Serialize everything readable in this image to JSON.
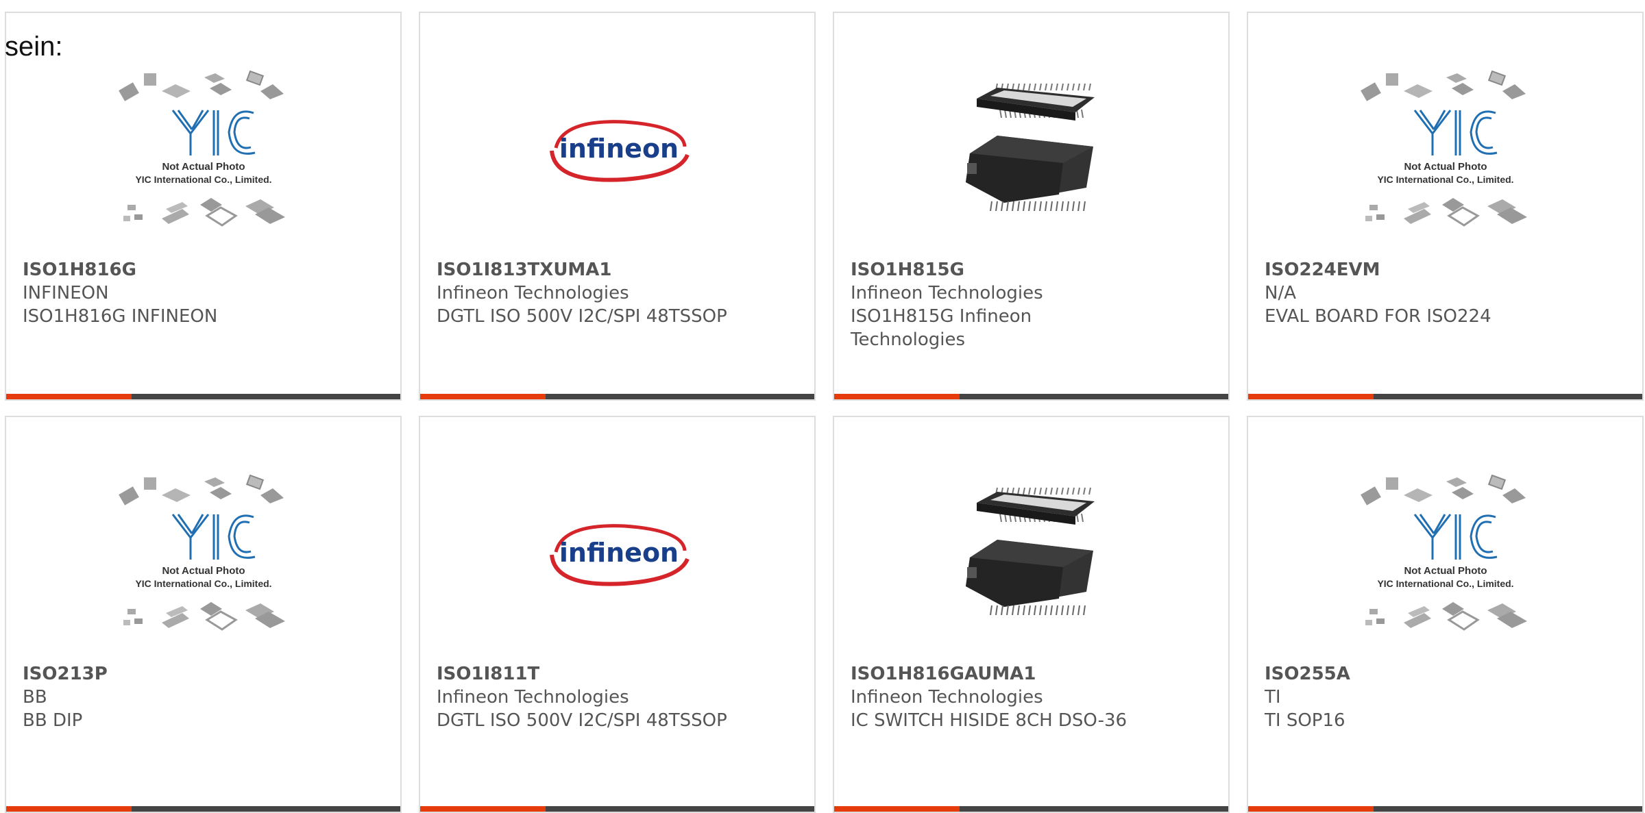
{
  "lead_text": "sein:",
  "placeholder": {
    "line1": "Not Actual Photo",
    "line2": "YIC International Co., Limited."
  },
  "brand_logo_text": "infineon",
  "colors": {
    "accent": "#e63c0c",
    "bar": "#444444",
    "text": "#555555",
    "yic_blue": "#1f6fb2",
    "infineon_red": "#d6242b",
    "infineon_blue": "#1a3f8a"
  },
  "products": [
    {
      "part": "ISO1H816G",
      "manufacturer": "INFINEON",
      "description": "ISO1H816G INFINEON",
      "image": "placeholder"
    },
    {
      "part": "ISO1I813TXUMA1",
      "manufacturer": "Infineon Technologies",
      "description": "DGTL ISO 500V I2C/SPI 48TSSOP",
      "image": "infineon-logo"
    },
    {
      "part": "ISO1H815G",
      "manufacturer": "Infineon Technologies",
      "description": "ISO1H815G Infineon Technologies",
      "image": "chip-photo"
    },
    {
      "part": "ISO224EVM",
      "manufacturer": "N/A",
      "description": "EVAL BOARD FOR ISO224",
      "image": "placeholder"
    },
    {
      "part": "ISO213P",
      "manufacturer": "BB",
      "description": "BB DIP",
      "image": "placeholder"
    },
    {
      "part": "ISO1I811T",
      "manufacturer": "Infineon Technologies",
      "description": "DGTL ISO 500V I2C/SPI 48TSSOP",
      "image": "infineon-logo"
    },
    {
      "part": "ISO1H816GAUMA1",
      "manufacturer": "Infineon Technologies",
      "description": "IC SWITCH HISIDE 8CH DSO-36",
      "image": "chip-photo"
    },
    {
      "part": "ISO255A",
      "manufacturer": "TI",
      "description": "TI SOP16",
      "image": "placeholder"
    }
  ]
}
